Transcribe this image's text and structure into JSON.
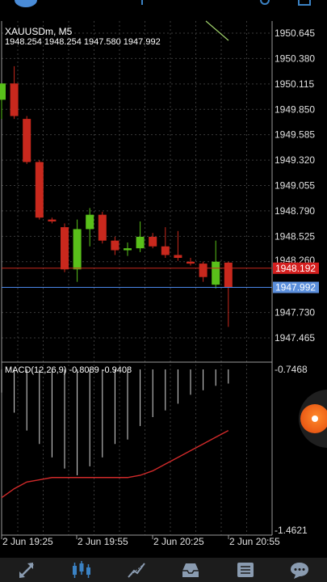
{
  "symbol_label": "XAUUSDm, M5",
  "ohlc_label": "1948.254 1948.254 1947.580 1947.992",
  "macd_label": "MACD(12,26,9) -0.8089 -0.9408",
  "colors": {
    "bull": "#59c01a",
    "bear": "#c8281d",
    "grid": "#3a3a3a",
    "bid_line": "#c8281d",
    "ask_line": "#4a86e8",
    "signal": "#d02a2a"
  },
  "price_axis": [
    "1950.645",
    "1950.380",
    "1950.115",
    "1949.850",
    "1949.585",
    "1949.320",
    "1949.055",
    "1948.790",
    "1948.525",
    "1948.260",
    "1947.730",
    "1947.465"
  ],
  "bid_label": "1948.192",
  "ask_label": "1947.992",
  "macd_axis": {
    "top": "-0.7468",
    "bottom": "-1.4621"
  },
  "time_axis": [
    "2 Jun 19:25",
    "2 Jun 19:55",
    "2 Jun 20:25",
    "2 Jun 20:55"
  ],
  "chart_data": {
    "type": "candlestick",
    "ylim": [
      1947.3,
      1950.75
    ],
    "candles": [
      {
        "o": 1949.95,
        "h": 1950.12,
        "l": 1949.75,
        "c": 1950.12
      },
      {
        "o": 1950.12,
        "h": 1950.3,
        "l": 1949.75,
        "c": 1949.78
      },
      {
        "o": 1949.75,
        "h": 1949.78,
        "l": 1949.28,
        "c": 1949.3
      },
      {
        "o": 1949.3,
        "h": 1949.32,
        "l": 1948.7,
        "c": 1948.72
      },
      {
        "o": 1948.7,
        "h": 1948.72,
        "l": 1948.66,
        "c": 1948.68
      },
      {
        "o": 1948.62,
        "h": 1948.66,
        "l": 1948.15,
        "c": 1948.18
      },
      {
        "o": 1948.18,
        "h": 1948.7,
        "l": 1948.05,
        "c": 1948.6
      },
      {
        "o": 1948.6,
        "h": 1948.82,
        "l": 1948.42,
        "c": 1948.75
      },
      {
        "o": 1948.75,
        "h": 1948.78,
        "l": 1948.45,
        "c": 1948.48
      },
      {
        "o": 1948.48,
        "h": 1948.52,
        "l": 1948.33,
        "c": 1948.38
      },
      {
        "o": 1948.38,
        "h": 1948.46,
        "l": 1948.32,
        "c": 1948.4
      },
      {
        "o": 1948.4,
        "h": 1948.68,
        "l": 1948.36,
        "c": 1948.52
      },
      {
        "o": 1948.52,
        "h": 1948.56,
        "l": 1948.4,
        "c": 1948.42
      },
      {
        "o": 1948.42,
        "h": 1948.62,
        "l": 1948.3,
        "c": 1948.33
      },
      {
        "o": 1948.33,
        "h": 1948.58,
        "l": 1948.27,
        "c": 1948.3
      },
      {
        "o": 1948.26,
        "h": 1948.3,
        "l": 1948.22,
        "c": 1948.24
      },
      {
        "o": 1948.24,
        "h": 1948.26,
        "l": 1948.05,
        "c": 1948.1
      },
      {
        "o": 1948.02,
        "h": 1948.48,
        "l": 1947.98,
        "c": 1948.26
      },
      {
        "o": 1948.25,
        "h": 1948.26,
        "l": 1947.58,
        "c": 1947.99
      }
    ],
    "macd_histogram": [
      -0.85,
      -0.94,
      -1.02,
      -1.08,
      -1.14,
      -1.19,
      -1.22,
      -1.18,
      -1.14,
      -1.08,
      -1.06,
      -1.0,
      -0.96,
      -0.93,
      -0.9,
      -0.86,
      -0.84,
      -0.82,
      -0.81
    ],
    "macd_signal": [
      -1.32,
      -1.28,
      -1.25,
      -1.24,
      -1.23,
      -1.23,
      -1.23,
      -1.23,
      -1.23,
      -1.23,
      -1.23,
      -1.22,
      -1.2,
      -1.17,
      -1.14,
      -1.11,
      -1.08,
      -1.05,
      -1.02
    ],
    "macd_ylim": [
      -1.4621,
      -0.7468
    ]
  }
}
